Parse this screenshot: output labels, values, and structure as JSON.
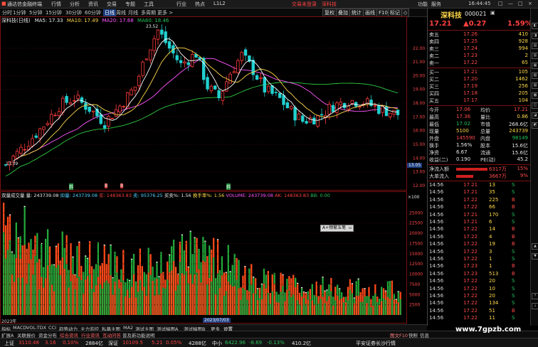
{
  "window": {
    "app_title": "通达信金融终端",
    "menu": [
      "行情",
      "分析",
      "资讯",
      "交易",
      "专题",
      "工具",
      "行业",
      "热点",
      "L1L2"
    ],
    "promo_link": "交易未登录",
    "promo_link2": "深科技",
    "right_menu": [
      "功能",
      "服务",
      "□",
      "—",
      "□",
      "×"
    ]
  },
  "periods": [
    "分时",
    "1分钟",
    "5分钟",
    "15分钟",
    "30分钟",
    "60分钟",
    "日线",
    "周线",
    "月线",
    "多周期",
    "更多 >"
  ],
  "active_period": "日线",
  "toolbar_buttons": [
    "复权",
    "叠加",
    "统计",
    "画线",
    "F10",
    "标记",
    "◇"
  ],
  "chart_header": {
    "title": "深科技(日线)",
    "ma5": "MA5: 17.33",
    "ma10": "MA10: 17.49",
    "ma20": "MA20: 17.68",
    "ma60": "MA60: 18.46"
  },
  "price_axis": [
    "22.00",
    "21.00",
    "20.00",
    "19.00",
    "18.00",
    "17.00",
    "16.00",
    "15.00",
    "14.00",
    "13.00",
    "12.00"
  ],
  "price_axis_highlight": "13.05",
  "high_label": "23.52",
  "low_label": "13.39",
  "volume_header": {
    "title": "双量成交量",
    "v1": "量: 243739.08",
    "v2": "抑量: 243739.08",
    "v3": "买: 148363.83",
    "v4": "卖: 95376.25",
    "v5": "买卖%: 1.56",
    "v6": "换手率%: 1.56",
    "v7": "VOLUME: 243739.08",
    "v8": "AK: 148363.83",
    "v9": "BB: 0.00"
  },
  "volume_axis": [
    "25000",
    "22500",
    "20000",
    "17500",
    "15000",
    "12500",
    "10000",
    "7500",
    "5000",
    "2500"
  ],
  "volume_unit": "×100",
  "date_label": "2023/07/03",
  "year_label": "2023年",
  "overlay_popup": "A+频繁五笔",
  "signal_marks": [
    "斜",
    "B",
    "B",
    "斜"
  ],
  "indicator_tabs": [
    "指标",
    "MACD",
    "VOL-TDX",
    "CCI",
    "趋势动力",
    "主力监控",
    "私募主图",
    "MA2",
    "测试主图",
    "测试幅图A",
    "测试幅图B",
    "更多",
    "设置"
  ],
  "bottom_tabs": [
    "扩展A",
    "关联报价",
    "资金分布",
    "综合资讯",
    "行业资讯",
    "互动问答",
    "普及新功能说明"
  ],
  "bottom_right": [
    "图文F10",
    "快照",
    "信息"
  ],
  "quote": {
    "name": "深科技",
    "code": "000021",
    "price": "17.21",
    "change": "▲0.27",
    "change_pct": "1.59%",
    "asks": [
      {
        "label": "卖五",
        "price": "17.26",
        "vol": "410"
      },
      {
        "label": "卖四",
        "price": "17.25",
        "vol": "928"
      },
      {
        "label": "卖三",
        "price": "17.24",
        "vol": "994"
      },
      {
        "label": "卖二",
        "price": "17.23",
        "vol": "2"
      },
      {
        "label": "卖一",
        "price": "17.22",
        "vol": "65"
      }
    ],
    "bids": [
      {
        "label": "买一",
        "price": "17.21",
        "vol": "105"
      },
      {
        "label": "买二",
        "price": "17.20",
        "vol": "1462"
      },
      {
        "label": "买三",
        "price": "17.19",
        "vol": "256"
      },
      {
        "label": "买四",
        "price": "17.18",
        "vol": "205"
      },
      {
        "label": "买五",
        "price": "17.17",
        "vol": "104"
      }
    ],
    "stats": [
      {
        "l1": "今开",
        "v1": "17.06",
        "l2": "均价",
        "v2": "17.21"
      },
      {
        "l1": "最高",
        "v1": "17.36",
        "l2": "量比",
        "v2": "0.86"
      },
      {
        "l1": "最低",
        "v1": "17.02",
        "l2": "市值",
        "v2": "268.6亿"
      },
      {
        "l1": "现量",
        "v1": "5100",
        "l2": "总量",
        "v2": "243739"
      },
      {
        "l1": "外盘",
        "v1": "145590",
        "l2": "内盘",
        "v2": "98149"
      },
      {
        "l1": "换手",
        "v1": "1.56%",
        "l2": "股本",
        "v2": "15.6亿"
      },
      {
        "l1": "净资",
        "v1": "6.67",
        "l2": "流通",
        "v2": "15.6亿"
      },
      {
        "l1": "收益(二)",
        "v1": "0.190",
        "l2": "PE(动)",
        "v2": "45.2"
      }
    ],
    "flows": [
      {
        "label": "净流入额",
        "value": "6317万",
        "pct": "15%"
      },
      {
        "label": "大单流入",
        "value": "3667万",
        "pct": "9%"
      }
    ],
    "ticks": [
      {
        "t": "14:56",
        "p": "17.21",
        "v": "13",
        "d": "S"
      },
      {
        "t": "14:56",
        "p": "17.21",
        "v": "35",
        "d": "S"
      },
      {
        "t": "14:56",
        "p": "17.22",
        "v": "225",
        "d": "B"
      },
      {
        "t": "14:56",
        "p": "17.22",
        "v": "66",
        "d": "B"
      },
      {
        "t": "14:56",
        "p": "17.21",
        "v": "170",
        "d": "S"
      },
      {
        "t": "14:56",
        "p": "17.21",
        "v": "6",
        "d": "S"
      },
      {
        "t": "14:56",
        "p": "17.22",
        "v": "14",
        "d": "B"
      },
      {
        "t": "14:56",
        "p": "17.22",
        "v": "4",
        "d": "B"
      },
      {
        "t": "14:56",
        "p": "17.22",
        "v": "19",
        "d": "B"
      },
      {
        "t": "14:56",
        "p": "17.22",
        "v": "3",
        "d": "S"
      },
      {
        "t": "14:56",
        "p": "17.22",
        "v": "1",
        "d": "S"
      },
      {
        "t": "14:56",
        "p": "17.23",
        "v": "1",
        "d": "B"
      },
      {
        "t": "14:56",
        "p": "17.23",
        "v": "513",
        "d": "B"
      },
      {
        "t": "14:56",
        "p": "17.22",
        "v": "20",
        "d": "S"
      },
      {
        "t": "14:56",
        "p": "17.22",
        "v": "10",
        "d": "S"
      },
      {
        "t": "14:56",
        "p": "17.22",
        "v": "20",
        "d": "S"
      },
      {
        "t": "14:56",
        "p": "17.22",
        "v": "134",
        "d": "S"
      },
      {
        "t": "14:56",
        "p": "17.22",
        "v": "51",
        "d": "B"
      },
      {
        "t": "14:56",
        "p": "17.22",
        "v": "11",
        "d": "S"
      }
    ]
  },
  "status": {
    "idx1_name": "上证",
    "idx1_val": "3110.48",
    "idx1_chg": "3.16",
    "idx1_pct": "0.10%",
    "idx1_amt": "2884亿",
    "idx2_name": "深证",
    "idx2_val": "10109.5",
    "idx2_chg": "5.21",
    "idx2_pct": "0.05%",
    "idx2_amt": "4288亿",
    "idx3_name": "中小",
    "idx3_val": "6422.96",
    "idx3_chg": "-8.69",
    "idx3_pct": "-0.13%",
    "idx3_amt": "410.2亿",
    "broker": "平安证券长沙行情"
  },
  "time": "16:44:45",
  "watermark": "www.7gpzb.com",
  "colors": {
    "up": "#ff3b3b",
    "down": "#22c35e",
    "ma5": "#ffffff",
    "ma10": "#ffd84a",
    "ma20": "#ff55ff",
    "ma60": "#2ecc40",
    "bg": "#000000",
    "volume_up": "#ff4a1a",
    "volume_down": "#22a83a"
  }
}
